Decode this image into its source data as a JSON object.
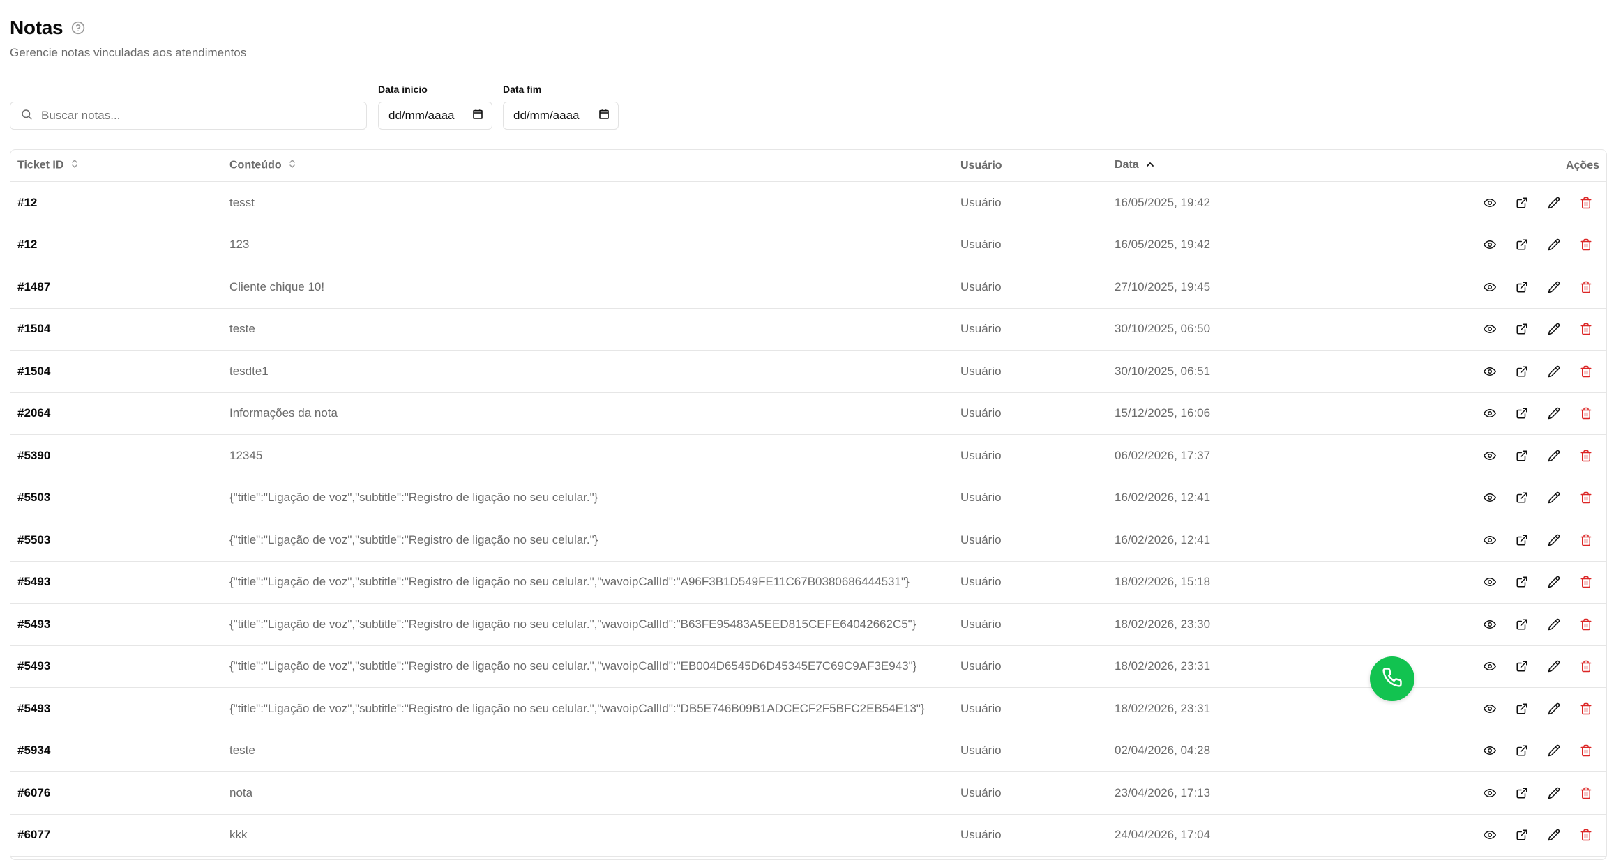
{
  "page": {
    "title": "Notas",
    "subtitle": "Gerencie notas vinculadas aos atendimentos",
    "help_icon": "help-circle-icon"
  },
  "filters": {
    "search_placeholder": "Buscar notas...",
    "date_start_label": "Data início",
    "date_start_value": "dd/mm/aaaa",
    "date_end_label": "Data fim",
    "date_end_value": "dd/mm/aaaa"
  },
  "table": {
    "headers": {
      "ticket_id": "Ticket ID",
      "content": "Conteúdo",
      "user": "Usuário",
      "date": "Data",
      "actions": "Ações"
    },
    "sort": {
      "column": "date",
      "direction": "asc"
    },
    "rows": [
      {
        "ticket": "#12",
        "content": "tesst",
        "user": "Usuário",
        "date": "16/05/2025, 19:42"
      },
      {
        "ticket": "#12",
        "content": "123",
        "user": "Usuário",
        "date": "16/05/2025, 19:42"
      },
      {
        "ticket": "#1487",
        "content": "Cliente chique 10!",
        "user": "Usuário",
        "date": "27/10/2025, 19:45"
      },
      {
        "ticket": "#1504",
        "content": "teste",
        "user": "Usuário",
        "date": "30/10/2025, 06:50"
      },
      {
        "ticket": "#1504",
        "content": "tesdte1",
        "user": "Usuário",
        "date": "30/10/2025, 06:51"
      },
      {
        "ticket": "#2064",
        "content": "Informações da nota",
        "user": "Usuário",
        "date": "15/12/2025, 16:06"
      },
      {
        "ticket": "#5390",
        "content": "12345",
        "user": "Usuário",
        "date": "06/02/2026, 17:37"
      },
      {
        "ticket": "#5503",
        "content": "{\"title\":\"Ligação de voz\",\"subtitle\":\"Registro de ligação no seu celular.\"}",
        "user": "Usuário",
        "date": "16/02/2026, 12:41"
      },
      {
        "ticket": "#5503",
        "content": "{\"title\":\"Ligação de voz\",\"subtitle\":\"Registro de ligação no seu celular.\"}",
        "user": "Usuário",
        "date": "16/02/2026, 12:41"
      },
      {
        "ticket": "#5493",
        "content": "{\"title\":\"Ligação de voz\",\"subtitle\":\"Registro de ligação no seu celular.\",\"wavoipCallId\":\"A96F3B1D549FE11C67B0380686444531\"}",
        "user": "Usuário",
        "date": "18/02/2026, 15:18"
      },
      {
        "ticket": "#5493",
        "content": "{\"title\":\"Ligação de voz\",\"subtitle\":\"Registro de ligação no seu celular.\",\"wavoipCallId\":\"B63FE95483A5EED815CEFE64042662C5\"}",
        "user": "Usuário",
        "date": "18/02/2026, 23:30"
      },
      {
        "ticket": "#5493",
        "content": "{\"title\":\"Ligação de voz\",\"subtitle\":\"Registro de ligação no seu celular.\",\"wavoipCallId\":\"EB004D6545D6D45345E7C69C9AF3E943\"}",
        "user": "Usuário",
        "date": "18/02/2026, 23:31"
      },
      {
        "ticket": "#5493",
        "content": "{\"title\":\"Ligação de voz\",\"subtitle\":\"Registro de ligação no seu celular.\",\"wavoipCallId\":\"DB5E746B09B1ADCECF2F5BFC2EB54E13\"}",
        "user": "Usuário",
        "date": "18/02/2026, 23:31"
      },
      {
        "ticket": "#5934",
        "content": "teste",
        "user": "Usuário",
        "date": "02/04/2026, 04:28"
      },
      {
        "ticket": "#6076",
        "content": "nota",
        "user": "Usuário",
        "date": "23/04/2026, 17:13"
      },
      {
        "ticket": "#6077",
        "content": "kkk",
        "user": "Usuário",
        "date": "24/04/2026, 17:04"
      }
    ],
    "row_actions": [
      "eye-icon",
      "external-link-icon",
      "pencil-icon",
      "trash-icon"
    ]
  },
  "fab": {
    "icon": "phone-icon",
    "color": "#12c350"
  },
  "colors": {
    "delete": "#dc2626",
    "muted_text": "#6b6b6b",
    "border": "#e6e6e6"
  }
}
